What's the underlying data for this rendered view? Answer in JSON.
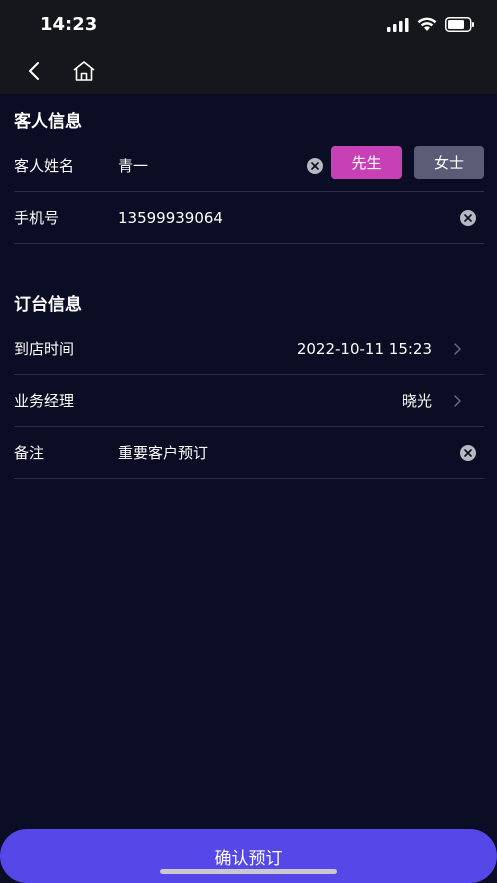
{
  "status_bar": {
    "time": "14:23"
  },
  "nav": {
    "back_icon": "chevron-left-icon",
    "home_icon": "home-icon"
  },
  "guest_section": {
    "title": "客人信息",
    "name_label": "客人姓名",
    "name_value": "青一",
    "gender_options": [
      "先生",
      "女士"
    ],
    "gender_selected": "先生",
    "phone_label": "手机号",
    "phone_value": "13599939064"
  },
  "booking_section": {
    "title": "订台信息",
    "arrival_label": "到店时间",
    "arrival_value": "2022-10-11 15:23",
    "manager_label": "业务经理",
    "manager_value": "晓光",
    "note_label": "备注",
    "note_value": "重要客户预订"
  },
  "footer": {
    "confirm_label": "确认预订"
  },
  "colors": {
    "background": "#0b0d24",
    "header": "#16171c",
    "selected_gender": "#c840b6",
    "unselected_gender": "#5a5d75",
    "confirm": "#5547e8",
    "divider": "#2a2d44"
  }
}
